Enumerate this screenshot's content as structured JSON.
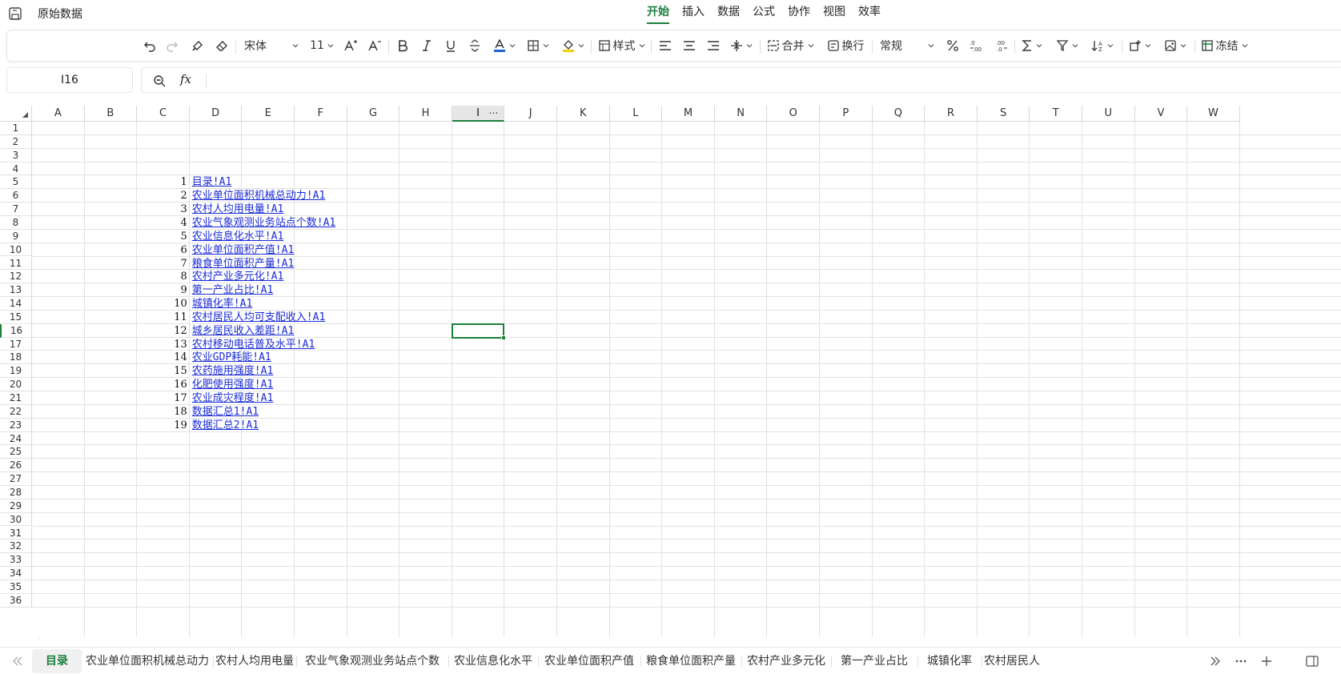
{
  "app": {
    "doc_title": "原始数据",
    "menu_tabs": [
      "开始",
      "插入",
      "数据",
      "公式",
      "协作",
      "视图",
      "效率"
    ]
  },
  "toolbar": {
    "font_name": "宋体",
    "font_size": "11",
    "style_label": "样式",
    "merge_label": "合并",
    "wrap_label": "换行",
    "number_format": "常规",
    "freeze_label": "冻结"
  },
  "formula_bar": {
    "cell_ref": "I16",
    "fx_label": "fx",
    "value": ""
  },
  "grid": {
    "columns": [
      "A",
      "B",
      "C",
      "D",
      "E",
      "F",
      "G",
      "H",
      "I",
      "J",
      "K",
      "L",
      "M",
      "N",
      "O",
      "P",
      "Q",
      "R",
      "S",
      "T",
      "U",
      "V",
      "W"
    ],
    "selected_column": "I",
    "selected_row": 16,
    "column_more": "⋯",
    "rows": [
      "1",
      "2",
      "3",
      "4",
      "5",
      "6",
      "7",
      "8",
      "9",
      "10",
      "11",
      "12",
      "13",
      "14",
      "15",
      "16",
      "17",
      "18",
      "19",
      "20",
      "21",
      "22",
      "23",
      "24",
      "25",
      "26",
      "27",
      "28",
      "29",
      "30",
      "31",
      "32",
      "33",
      "34",
      "35",
      "36"
    ],
    "entries": [
      {
        "row": 5,
        "num": "1",
        "link": "目录!A1"
      },
      {
        "row": 6,
        "num": "2",
        "link": "农业单位面积机械总动力!A1"
      },
      {
        "row": 7,
        "num": "3",
        "link": "农村人均用电量!A1"
      },
      {
        "row": 8,
        "num": "4",
        "link": "农业气象观测业务站点个数!A1"
      },
      {
        "row": 9,
        "num": "5",
        "link": "农业信息化水平!A1"
      },
      {
        "row": 10,
        "num": "6",
        "link": "农业单位面积产值!A1"
      },
      {
        "row": 11,
        "num": "7",
        "link": "粮食单位面积产量!A1"
      },
      {
        "row": 12,
        "num": "8",
        "link": "农村产业多元化!A1"
      },
      {
        "row": 13,
        "num": "9",
        "link": "第一产业占比!A1"
      },
      {
        "row": 14,
        "num": "10",
        "link": "城镇化率!A1"
      },
      {
        "row": 15,
        "num": "11",
        "link": "农村居民人均可支配收入!A1"
      },
      {
        "row": 16,
        "num": "12",
        "link": "城乡居民收入差距!A1"
      },
      {
        "row": 17,
        "num": "13",
        "link": "农村移动电话普及水平!A1"
      },
      {
        "row": 18,
        "num": "14",
        "link": "农业GDP耗能!A1"
      },
      {
        "row": 19,
        "num": "15",
        "link": "农药施用强度!A1"
      },
      {
        "row": 20,
        "num": "16",
        "link": "化肥使用强度!A1"
      },
      {
        "row": 21,
        "num": "17",
        "link": "农业成灾程度!A1"
      },
      {
        "row": 22,
        "num": "18",
        "link": "数据汇总1!A1"
      },
      {
        "row": 23,
        "num": "19",
        "link": "数据汇总2!A1"
      }
    ]
  },
  "sheets": {
    "tabs": [
      "目录",
      "农业单位面积机械总动力",
      "农村人均用电量",
      "农业气象观测业务站点个数",
      "农业信息化水平",
      "农业单位面积产值",
      "粮食单位面积产量",
      "农村产业多元化",
      "第一产业占比",
      "城镇化率",
      "农村居民人"
    ],
    "active_index": 0
  },
  "colors": {
    "accent": "#1b7f3b",
    "link": "#1a2bd6",
    "grid": "#e2e2e2"
  }
}
